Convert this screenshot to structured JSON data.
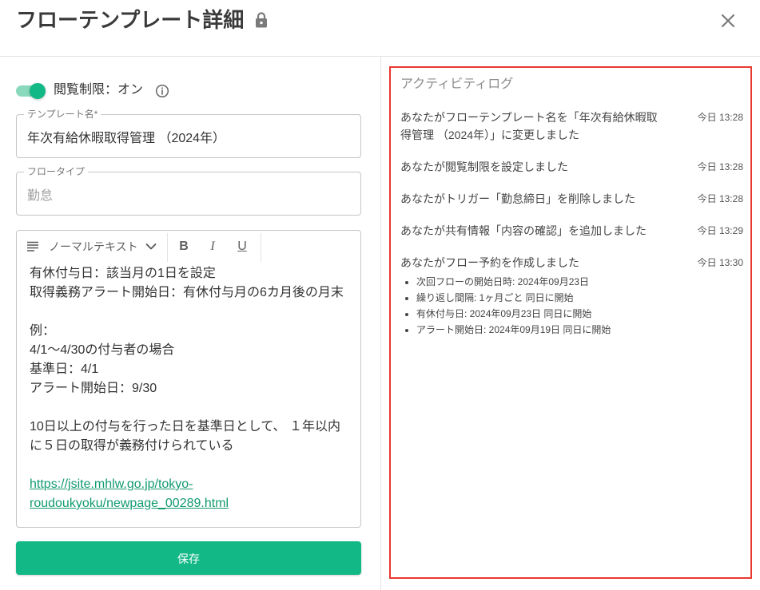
{
  "header": {
    "title": "フローテンプレート詳細"
  },
  "icons": {
    "lock": "lock-icon",
    "close": "close-icon",
    "info": "info-icon",
    "block_style": "notes-icon",
    "dropdown": "chevron-down-icon"
  },
  "view_restriction": {
    "label": "閲覧制限：オン",
    "enabled": true
  },
  "template_name": {
    "label": "テンプレート名*",
    "value": "年次有給休暇取得管理 （2024年）"
  },
  "flow_type": {
    "label": "フロータイプ",
    "value": "勤怠"
  },
  "editor": {
    "toolbar": {
      "block_style": "ノーマルテキスト",
      "bold": "B",
      "italic": "I",
      "underline": "U"
    },
    "paragraphs": [
      "有休付与日：該当月の1日を設定",
      "取得義務アラート開始日：有休付与月の6カ月後の月末",
      "",
      "例：",
      "4/1〜4/30の付与者の場合",
      "基準日：4/1",
      "アラート開始日：9/30",
      "",
      "10日以上の付与を行った日を基準日として、 １年以内に５日の取得が義務付けられている",
      ""
    ],
    "link": "https://jsite.mhlw.go.jp/tokyo-roudoukyoku/newpage_00289.html"
  },
  "save_label": "保存",
  "activity": {
    "title": "アクティビティログ",
    "items": [
      {
        "text": "あなたがフローテンプレート名を「年次有給休暇取得管理 （2024年）」に変更しました",
        "time": "今日 13:28"
      },
      {
        "text": "あなたが閲覧制限を設定しました",
        "time": "今日 13:28"
      },
      {
        "text": "あなたがトリガー「勤怠締日」を削除しました",
        "time": "今日 13:28"
      },
      {
        "text": "あなたが共有情報「内容の確認」を追加しました",
        "time": "今日 13:29"
      },
      {
        "text": "あなたがフロー予約を作成しました",
        "time": "今日 13:30",
        "details": [
          "次回フローの開始日時: 2024年09月23日",
          "繰り返し間隔: 1ヶ月ごと 同日に開始",
          "有休付与日: 2024年09月23日 同日に開始",
          "アラート開始日: 2024年09月19日 同日に開始"
        ]
      }
    ]
  },
  "colors": {
    "accent": "#12b886",
    "accent_light": "#8bd9bd",
    "link": "#129a70",
    "highlight_border": "#e8392f"
  }
}
